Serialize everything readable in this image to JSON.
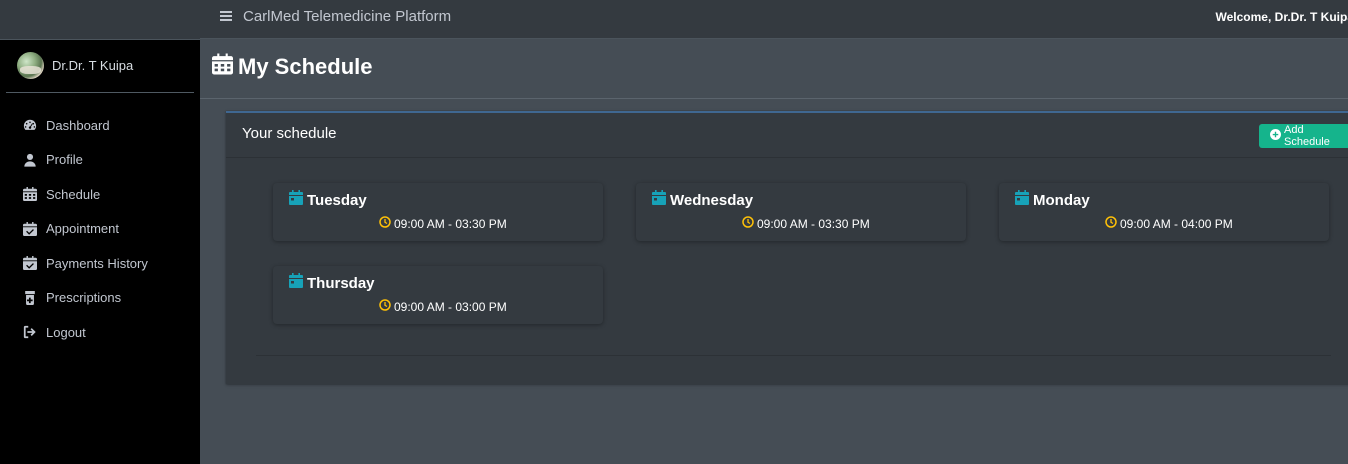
{
  "app": {
    "title": "CarlMed Telemedicine Platform",
    "welcome": "Welcome, Dr.Dr. T Kuipa"
  },
  "user": {
    "name": "Dr.Dr. T Kuipa"
  },
  "sidebar": {
    "items": [
      {
        "label": "Dashboard",
        "icon": "dashboard-gauge-icon"
      },
      {
        "label": "Profile",
        "icon": "user-icon"
      },
      {
        "label": "Schedule",
        "icon": "calendar-icon"
      },
      {
        "label": "Appointment",
        "icon": "calendar-check-icon"
      },
      {
        "label": "Payments History",
        "icon": "calendar-check-icon"
      },
      {
        "label": "Prescriptions",
        "icon": "prescription-bottle-icon"
      },
      {
        "label": "Logout",
        "icon": "sign-out-icon"
      }
    ]
  },
  "page": {
    "title": "My Schedule"
  },
  "card": {
    "title": "Your schedule",
    "add_button": "Add Schedule",
    "schedules": [
      {
        "day": "Tuesday",
        "time": "09:00 AM - 03:30 PM"
      },
      {
        "day": "Wednesday",
        "time": "09:00 AM - 03:30 PM"
      },
      {
        "day": "Monday",
        "time": "09:00 AM - 04:00 PM"
      },
      {
        "day": "Thursday",
        "time": "09:00 AM - 03:00 PM"
      }
    ]
  },
  "colors": {
    "accent_teal": "#17a2b8",
    "clock_yellow": "#ffc107",
    "button_green": "#15b48c",
    "sidebar_bg": "#000000",
    "content_bg": "#454d55"
  }
}
